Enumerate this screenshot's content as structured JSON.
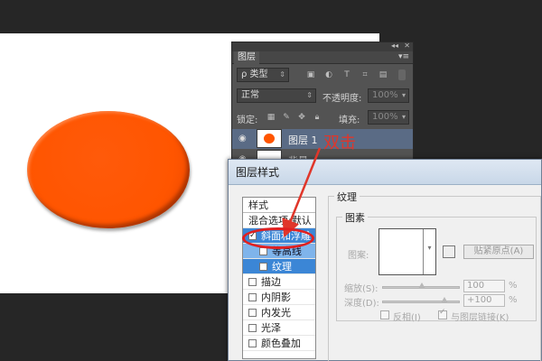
{
  "layers_panel": {
    "collapse_glyph": "◂◂",
    "close_glyph": "✕",
    "tab": "图层",
    "menu_glyph": "▾≡",
    "kind_filter": "ρ 类型",
    "blend_mode": "正常",
    "opacity_label": "不透明度:",
    "opacity_value": "100%",
    "lock_label": "锁定:",
    "fill_label": "填充:",
    "fill_value": "100%",
    "layer_name": "图层 1",
    "partial_layer_name": "背景"
  },
  "annotation": {
    "text": "双击",
    "color": "#e0362a"
  },
  "dialog": {
    "title": "图层样式",
    "styles_header": "样式",
    "styles": [
      {
        "label": "混合选项:默认",
        "checkbox": false,
        "checked": false,
        "state": "plain"
      },
      {
        "label": "斜面和浮雕",
        "checkbox": true,
        "checked": true,
        "state": "selected"
      },
      {
        "label": "等高线",
        "checkbox": true,
        "checked": false,
        "state": "sub"
      },
      {
        "label": "纹理",
        "checkbox": true,
        "checked": false,
        "state": "sub-selected"
      },
      {
        "label": "描边",
        "checkbox": true,
        "checked": false,
        "state": "normal"
      },
      {
        "label": "内阴影",
        "checkbox": true,
        "checked": false,
        "state": "normal"
      },
      {
        "label": "内发光",
        "checkbox": true,
        "checked": false,
        "state": "normal"
      },
      {
        "label": "光泽",
        "checkbox": true,
        "checked": false,
        "state": "normal"
      },
      {
        "label": "颜色叠加",
        "checkbox": true,
        "checked": false,
        "state": "normal"
      }
    ],
    "texture_group": "纹理",
    "pattern_group": "图素",
    "pattern_label": "图案:",
    "snap_button": "贴紧原点(A)",
    "scale_label": "缩放(S):",
    "scale_value": "100",
    "depth_label": "深度(D):",
    "depth_value": "+100",
    "percent": "%",
    "invert_label": "反相(I)",
    "link_label": "与图层链接(K)"
  },
  "colors": {
    "accent_selection": "#3b86d6",
    "layer_fill": "#ff5500"
  }
}
